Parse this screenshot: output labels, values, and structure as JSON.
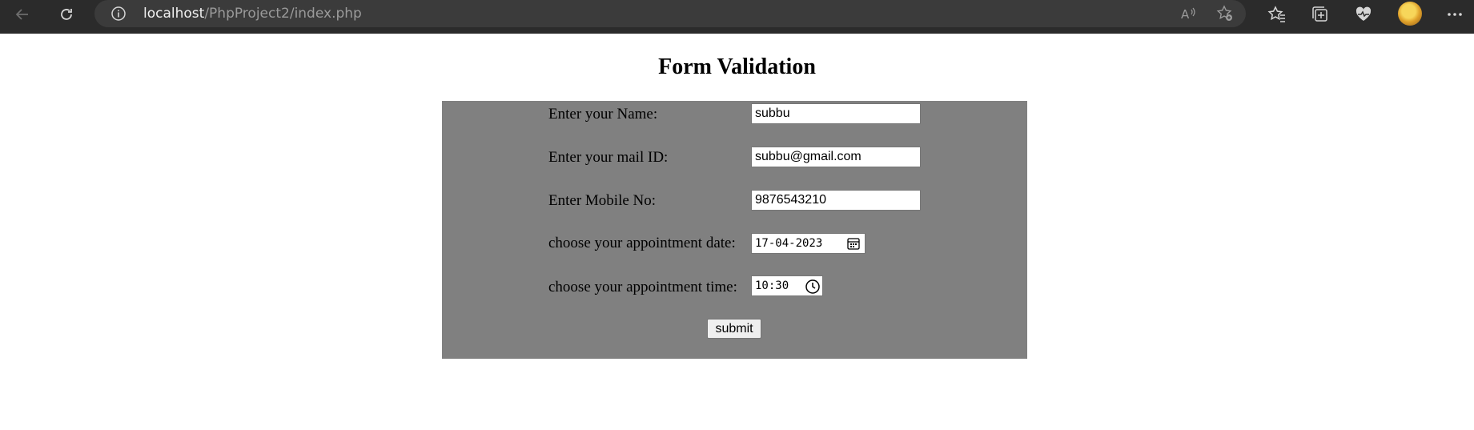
{
  "browser": {
    "url_host": "localhost",
    "url_path": "/PhpProject2/index.php",
    "icons": [
      "back-icon",
      "refresh-icon",
      "site-info-icon",
      "read-aloud-icon",
      "add-favorite-icon",
      "favorites-icon",
      "collections-icon",
      "health-icon",
      "profile-avatar",
      "more-icon"
    ]
  },
  "page": {
    "title": "Form Validation"
  },
  "form": {
    "panel_color": "#808080",
    "name_label": "Enter your Name:",
    "name_value": "subbu",
    "email_label": "Enter your mail ID:",
    "email_value": "subbu@gmail.com",
    "mobile_label": "Enter Mobile No:",
    "mobile_value": "9876543210",
    "date_label": "choose your appointment date:",
    "date_value": "17-04-2023",
    "time_label": "choose your appointment time:",
    "time_value": "10:30",
    "submit_label": "submit"
  }
}
